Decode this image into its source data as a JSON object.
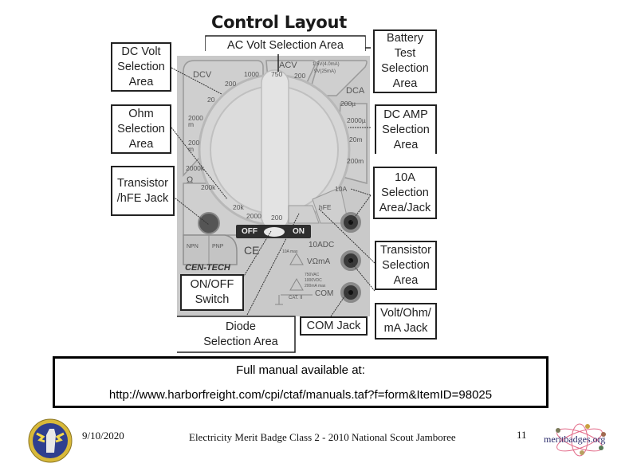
{
  "slide": {
    "title": "Control Layout",
    "callouts": {
      "dc_volt": [
        "DC Volt",
        "Selection",
        "Area"
      ],
      "ac_volt": [
        "AC Volt Selection Area"
      ],
      "battery_test": [
        "Battery",
        "Test",
        "Selection",
        "Area"
      ],
      "ohm": [
        "Ohm",
        "Selection",
        "Area"
      ],
      "dc_amp": [
        "DC AMP",
        "Selection",
        "Area"
      ],
      "transistor_jack": [
        "Transistor",
        "/hFE Jack"
      ],
      "ten_amp": [
        "10A",
        "Selection",
        "Area/Jack"
      ],
      "transistor_selection": [
        "Transistor",
        "Selection",
        "Area"
      ],
      "on_off": [
        "ON/OFF",
        "Switch"
      ],
      "volt_ohm_ma": [
        "Volt/Ohm/",
        "mA Jack"
      ],
      "diode": [
        "Diode",
        "Selection Area"
      ],
      "com_jack": [
        "COM Jack"
      ]
    },
    "meter": {
      "dcv": "DCV",
      "acv": "ACV",
      "dca": "DCA",
      "ohm_symbol": "Ω",
      "battery_1": "1.5V(4.0mA)",
      "battery_2": "9V(25mA)",
      "dcv_ranges": [
        "1000",
        "200",
        "20",
        "2000 m",
        "200 m"
      ],
      "acv_ranges": [
        "750",
        "200"
      ],
      "dca_ranges": [
        "200µ",
        "2000µ",
        "20m",
        "200m"
      ],
      "ohm_ranges": [
        "2000k",
        "200k",
        "20k",
        "2000",
        "200"
      ],
      "ten_a": "10A",
      "hfe": "hFE",
      "switch_off": "OFF",
      "switch_on": "ON",
      "jack_10adc": "10ADC",
      "jack_10a_max": "10A max",
      "jack_vohm": "VΩmA",
      "jack_com": "COM",
      "rating_1": "750VAC",
      "rating_2": "1000VDC",
      "rating_3": "200mA max",
      "cat": "CAT. II",
      "npn": "NPN",
      "pnp": "PNP",
      "ce": "CE",
      "brand": "CEN-TECH"
    },
    "manual_box": {
      "line1": "Full manual available at:",
      "line2": "http://www.harborfreight.com/cpi/ctaf/manuals.taf?f=form&ItemID=98025"
    },
    "footer": {
      "date": "9/10/2020",
      "center": "Electricity Merit Badge Class 2 - 2010 National Scout Jamboree",
      "page": "11",
      "logo_text": "meritbadges.org"
    }
  }
}
